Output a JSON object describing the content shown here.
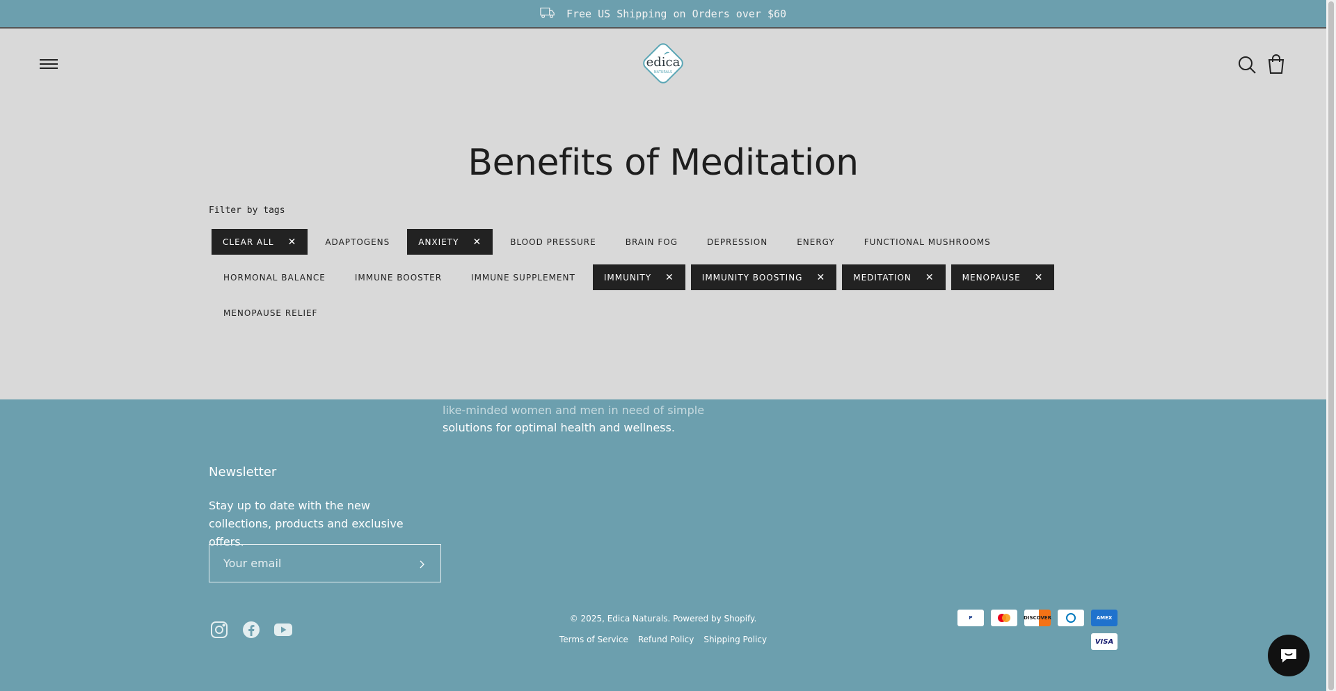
{
  "announcement": {
    "text": "Free US Shipping on Orders over $60"
  },
  "header": {
    "logo_text": "edica",
    "logo_subtext": "NATURALS"
  },
  "page": {
    "title": "Benefits of Meditation",
    "filter_label": "Filter by tags"
  },
  "tags": [
    [
      {
        "label": "CLEAR ALL",
        "active": true
      },
      {
        "label": "ADAPTOGENS",
        "active": false
      },
      {
        "label": "ANXIETY",
        "active": true
      },
      {
        "label": "BLOOD PRESSURE",
        "active": false
      },
      {
        "label": "BRAIN FOG",
        "active": false
      },
      {
        "label": "DEPRESSION",
        "active": false
      },
      {
        "label": "ENERGY",
        "active": false
      },
      {
        "label": "FUNCTIONAL MUSHROOMS",
        "active": false
      }
    ],
    [
      {
        "label": "HORMONAL BALANCE",
        "active": false
      },
      {
        "label": "IMMUNE BOOSTER",
        "active": false
      },
      {
        "label": "IMMUNE SUPPLEMENT",
        "active": false
      },
      {
        "label": "IMMUNITY",
        "active": true
      },
      {
        "label": "IMMUNITY BOOSTING",
        "active": true
      },
      {
        "label": "MEDITATION",
        "active": true
      },
      {
        "label": "MENOPAUSE",
        "active": true
      }
    ],
    [
      {
        "label": "MENOPAUSE RELIEF",
        "active": false
      }
    ]
  ],
  "footer": {
    "about_fade": "like-minded women and men in need of simple",
    "about_text": "solutions for optimal health and wellness.",
    "newsletter_title": "Newsletter",
    "newsletter_desc": "Stay up to date with the new collections, products and exclusive offers.",
    "email_placeholder": "Your email",
    "copyright": "© 2025, Edica Naturals. Powered by Shopify.",
    "policies": [
      "Terms of Service",
      "Refund Policy",
      "Shipping Policy"
    ],
    "payments": [
      "PayPal",
      "Mastercard",
      "DISCOVER",
      "Diners",
      "AMEX",
      "VISA"
    ]
  },
  "colors": {
    "brand_blue": "#6c9fae",
    "background": "#d9d9d9",
    "active_tag": "#222222"
  }
}
